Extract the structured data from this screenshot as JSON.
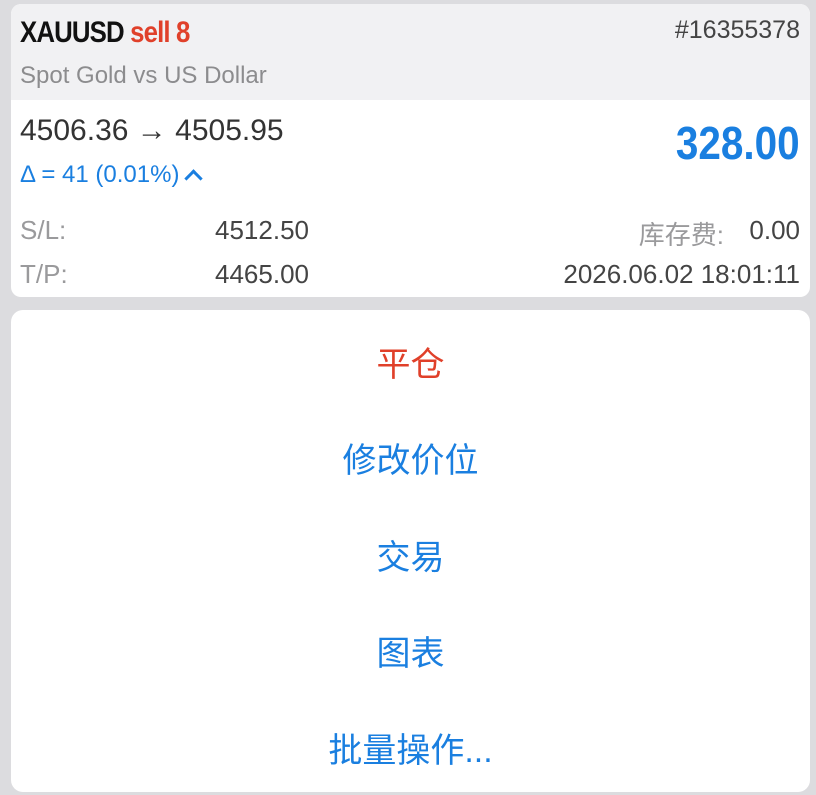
{
  "position": {
    "symbol": "XAUUSD",
    "side": "sell",
    "volume": "8",
    "ticket": "#16355378",
    "description": "Spot Gold vs US Dollar",
    "open_price": "4506.36",
    "arrow": "→",
    "current_price": "4505.95",
    "delta": "Δ = 41 (0.01%)",
    "profit": "328.00",
    "sl_label": "S/L:",
    "sl_value": "4512.50",
    "tp_label": "T/P:",
    "tp_value": "4465.00",
    "swap_label": "库存费:",
    "swap_value": "0.00",
    "datetime": "2026.06.02 18:01:11"
  },
  "menu": {
    "items": [
      {
        "label": "平仓"
      },
      {
        "label": "修改价位"
      },
      {
        "label": "交易"
      },
      {
        "label": "图表"
      },
      {
        "label": "批量操作..."
      }
    ]
  },
  "colors": {
    "accent": "#1a7fe0",
    "danger": "#e0402a",
    "background": "#dcdcdf"
  },
  "icons": {
    "delta_toggle": "chevron-up-icon"
  }
}
